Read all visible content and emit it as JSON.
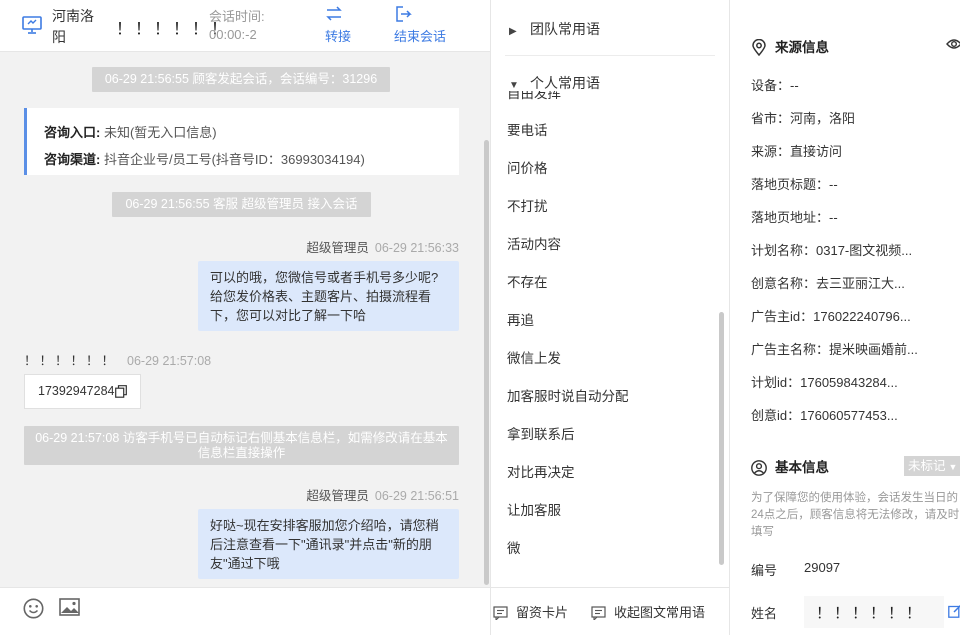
{
  "chat": {
    "header": {
      "location": "河南洛阳",
      "customer_name": "！！！！！！",
      "session_time_label": "会话时间:",
      "session_time_value": "00:00:-2",
      "transfer_label": "转接",
      "end_label": "结束会话"
    },
    "system_messages": [
      "06-29 21:56:55 顾客发起会话，会话编号：31296",
      "06-29 21:56:55 客服 超级管理员 接入会话",
      "06-29 21:57:08 访客手机号已自动标记右侧基本信息栏，如需修改请在基本信息栏直接操作"
    ],
    "entry_card": {
      "entry_label": "咨询入口:",
      "entry_value": "未知(暂无入口信息)",
      "channel_label": "咨询渠道:",
      "channel_value": "抖音企业号/员工号(抖音号ID：36993034194)"
    },
    "messages": [
      {
        "sender": "超级管理员",
        "time": "06-29 21:56:33",
        "text": "可以的哦，您微信号或者手机号多少呢?给您发价格表、主题客片、拍摄流程看下，您可以对比了解一下哈"
      },
      {
        "sender": "！！！！！！",
        "time": "06-29 21:57:08",
        "text": "17392947284"
      },
      {
        "sender": "超级管理员",
        "time": "06-29 21:56:51",
        "text": "好哒~现在安排客服加您介绍哈，请您稍后注意查看一下\"通讯录\"并点击\"新的朋友\"通过下哦"
      }
    ]
  },
  "phrases": {
    "team_group": "团队常用语",
    "personal_group": "个人常用语",
    "clipped_item": "自由发挥",
    "items": [
      "要电话",
      "问价格",
      "不打扰",
      "活动内容",
      "不存在",
      "再追",
      "微信上发",
      "加客服时说自动分配",
      "拿到联系后",
      "对比再决定",
      "让加客服",
      "微"
    ],
    "toolbar": {
      "card_label": "留资卡片",
      "collapse_label": "收起图文常用语"
    }
  },
  "info": {
    "source_title": "来源信息",
    "source_rows": [
      {
        "label": "设备：",
        "value": "--"
      },
      {
        "label": "省市：",
        "value": "河南，洛阳"
      },
      {
        "label": "来源：",
        "value": "直接访问"
      },
      {
        "label": "落地页标题：",
        "value": "--"
      },
      {
        "label": "落地页地址：",
        "value": "--"
      },
      {
        "label": "计划名称：",
        "value": "0317-图文视频..."
      },
      {
        "label": "创意名称：",
        "value": "去三亚丽江大..."
      },
      {
        "label": "广告主id：",
        "value": "176022240796..."
      },
      {
        "label": "广告主名称：",
        "value": "提米映画婚前..."
      },
      {
        "label": "计划id：",
        "value": "176059843284..."
      },
      {
        "label": "创意id：",
        "value": "176060577453..."
      }
    ],
    "basic_title": "基本信息",
    "mark_select": "未标记",
    "basic_note": "为了保障您的使用体验，会话发生当日的24点之后，顾客信息将无法修改，请及时填写",
    "id_label": "编号",
    "id_value": "29097",
    "name_label": "姓名",
    "name_value": "！！！！！！"
  },
  "colors": {
    "accent": "#3d7be3",
    "bubble": "#dce8fb",
    "system_msg": "#d4d4d4",
    "chat_bg": "#f2f2f2"
  }
}
